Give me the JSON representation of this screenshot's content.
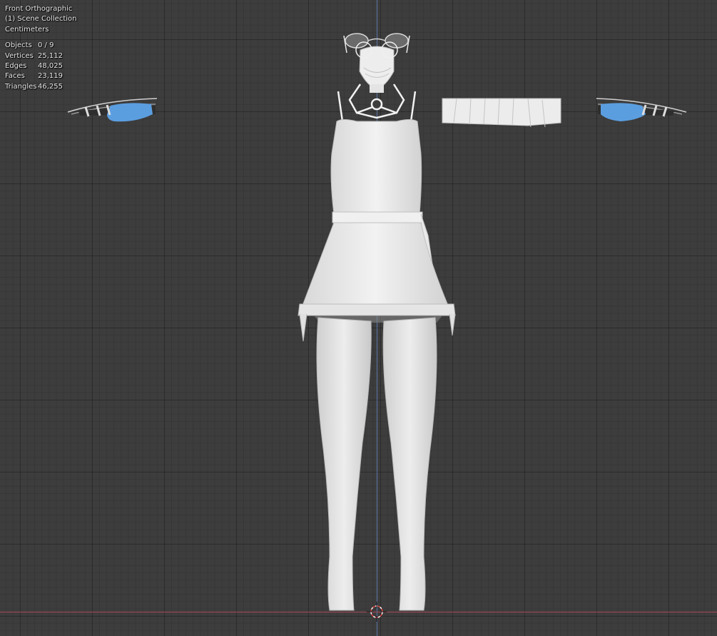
{
  "viewport": {
    "view_name": "Front Orthographic",
    "collection": "(1) Scene Collection",
    "units": "Centimeters",
    "stats": [
      {
        "label": "Objects",
        "value": "0 / 9"
      },
      {
        "label": "Vertices",
        "value": "25,112"
      },
      {
        "label": "Edges",
        "value": "48,025"
      },
      {
        "label": "Faces",
        "value": "23,119"
      },
      {
        "label": "Triangles",
        "value": "46,255"
      }
    ]
  },
  "colors": {
    "background": "#3d3d3d",
    "model": "#e6e6e6",
    "glove_accent": "#5b9ee0",
    "x_axis": "#b0485a",
    "z_axis": "#5e7fb8"
  }
}
